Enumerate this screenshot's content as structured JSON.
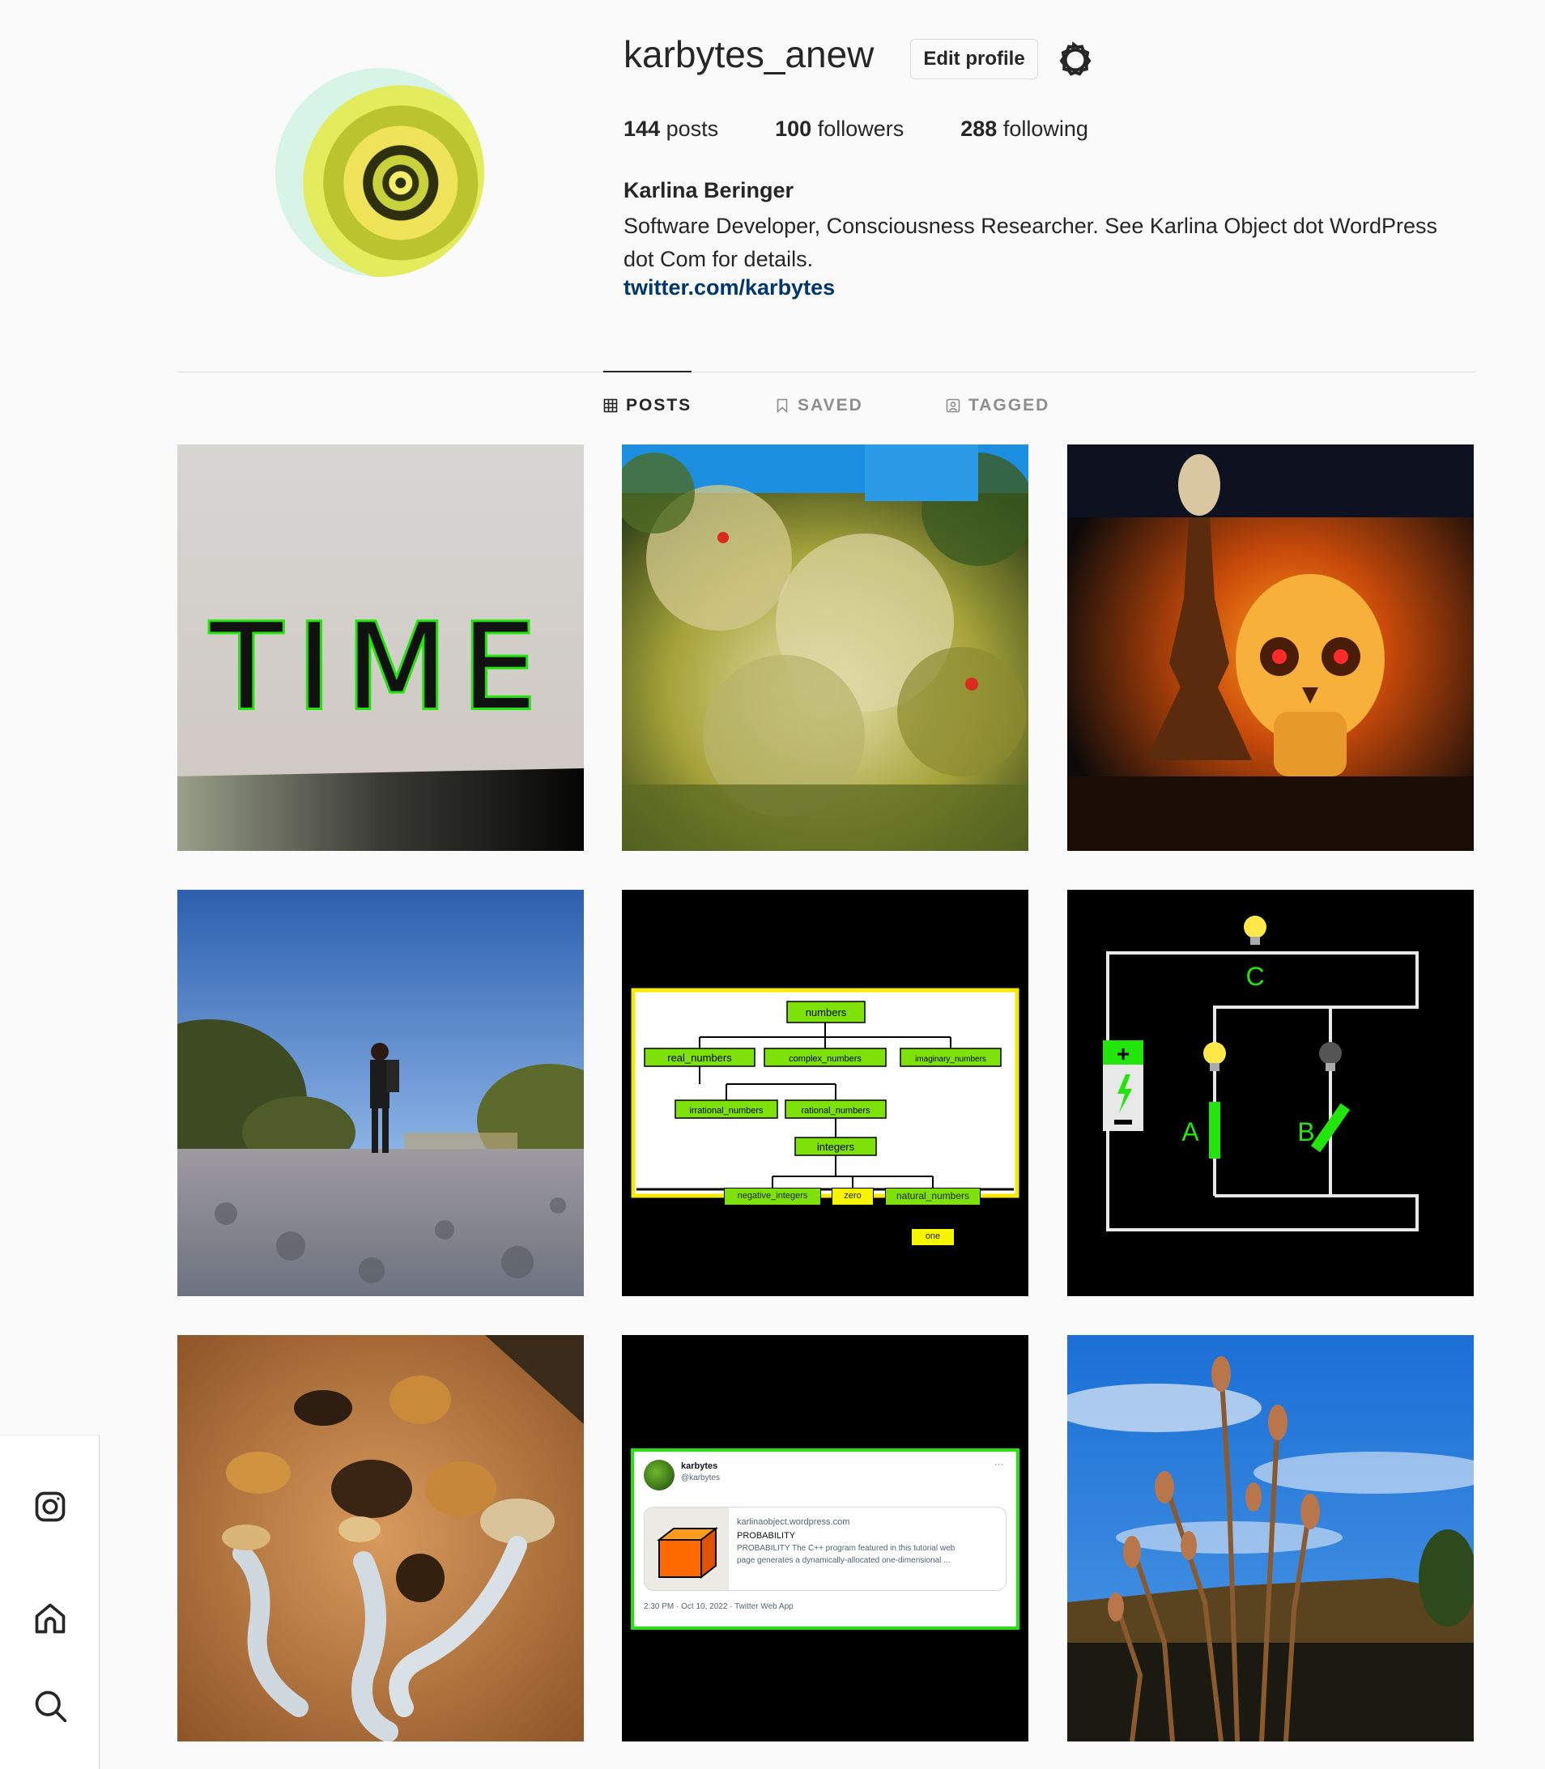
{
  "profile": {
    "username": "karbytes_anew",
    "edit_label": "Edit profile",
    "posts_count": "144",
    "posts_label": "posts",
    "followers_count": "100",
    "followers_label": "followers",
    "following_count": "288",
    "following_label": "following",
    "name": "Karlina Beringer",
    "bio": "Software Developer, Consciousness Researcher. See Karlina Object dot WordPress dot Com for details.",
    "link": "twitter.com/karbytes"
  },
  "tabs": [
    {
      "label": "POSTS",
      "icon": "grid-icon",
      "active": true
    },
    {
      "label": "SAVED",
      "icon": "bookmark-icon",
      "active": false
    },
    {
      "label": "TAGGED",
      "icon": "tag-icon",
      "active": false
    }
  ],
  "posts": {
    "p1": {
      "text": "TIME"
    },
    "p5": {
      "n1": "numbers",
      "n2": "real_numbers",
      "n3": "complex_numbers",
      "n4": "imaginary_numbers",
      "n5": "irrational_numbers",
      "n6": "rational_numbers",
      "n7": "integers",
      "n8": "negative_integers",
      "n9": "zero",
      "n10": "natural_numbers",
      "n11": "one"
    },
    "p6": {
      "a": "A",
      "b": "B",
      "c": "C"
    },
    "p8": {
      "name": "karbytes",
      "handle": "@karbytes",
      "more": "···",
      "domain": "karlinaobject.wordpress.com",
      "title": "PROBABILITY",
      "desc1": "PROBABILITY The C++ program featured in this tutorial web",
      "desc2": "page generates a dynamically-allocated one-dimensional ...",
      "meta": "2:30 PM · Oct 10, 2022 · Twitter Web App"
    }
  },
  "nav": [
    "instagram-icon",
    "home-icon",
    "search-icon"
  ],
  "colors": {
    "link": "#00376b",
    "text": "#262626",
    "muted": "#8e8e8e",
    "neon_green": "#22e60a"
  }
}
